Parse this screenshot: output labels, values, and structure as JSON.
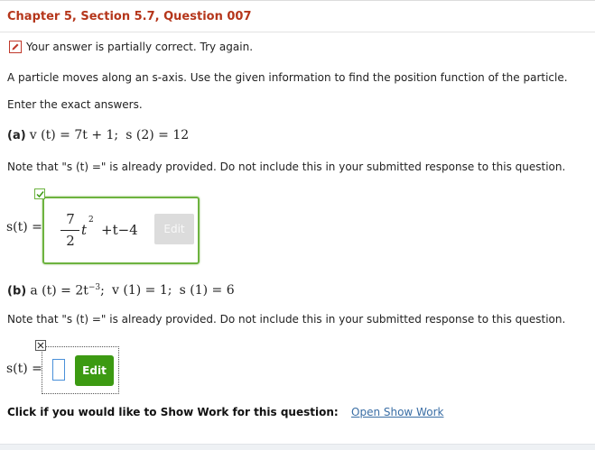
{
  "header": {
    "title": "Chapter 5, Section 5.7, Question 007"
  },
  "status": {
    "message": "Your answer is partially correct.  Try again.",
    "icon": "pencil-icon",
    "color": "#c0392b"
  },
  "problem": {
    "statement": "A particle moves along an s-axis. Use the given information to find the position function of the particle.",
    "instruction": "Enter the exact answers."
  },
  "part_a": {
    "label": "(a)",
    "given": {
      "v_lhs": "v (t) = 7t + 1;",
      "s_lhs": "s (2) = 12"
    },
    "note": "Note that \"s (t) =\" is already provided. Do not include this in your submitted response to this question.",
    "answer_label": "s(t) =",
    "answer": {
      "numerator": "7",
      "denominator": "2",
      "var": "t",
      "exp": "2",
      "rest": "+t−4"
    },
    "edit_label": "Edit",
    "checkbox_color": "#6db33f"
  },
  "part_b": {
    "label": "(b)",
    "given": {
      "a_lhs": "a (t) = 2t",
      "a_exp": "−3",
      "a_end": ";",
      "v": "v (1) = 1;",
      "s": "s (1) = 6"
    },
    "note": "Note that \"s (t) =\" is already provided. Do not include this in your submitted response to this question.",
    "answer_label": "s(t) =",
    "edit_label": "Edit",
    "edit_color": "#3c9a12"
  },
  "show_work": {
    "prompt": "Click if you would like to Show Work for this question:",
    "link": "Open Show Work"
  }
}
